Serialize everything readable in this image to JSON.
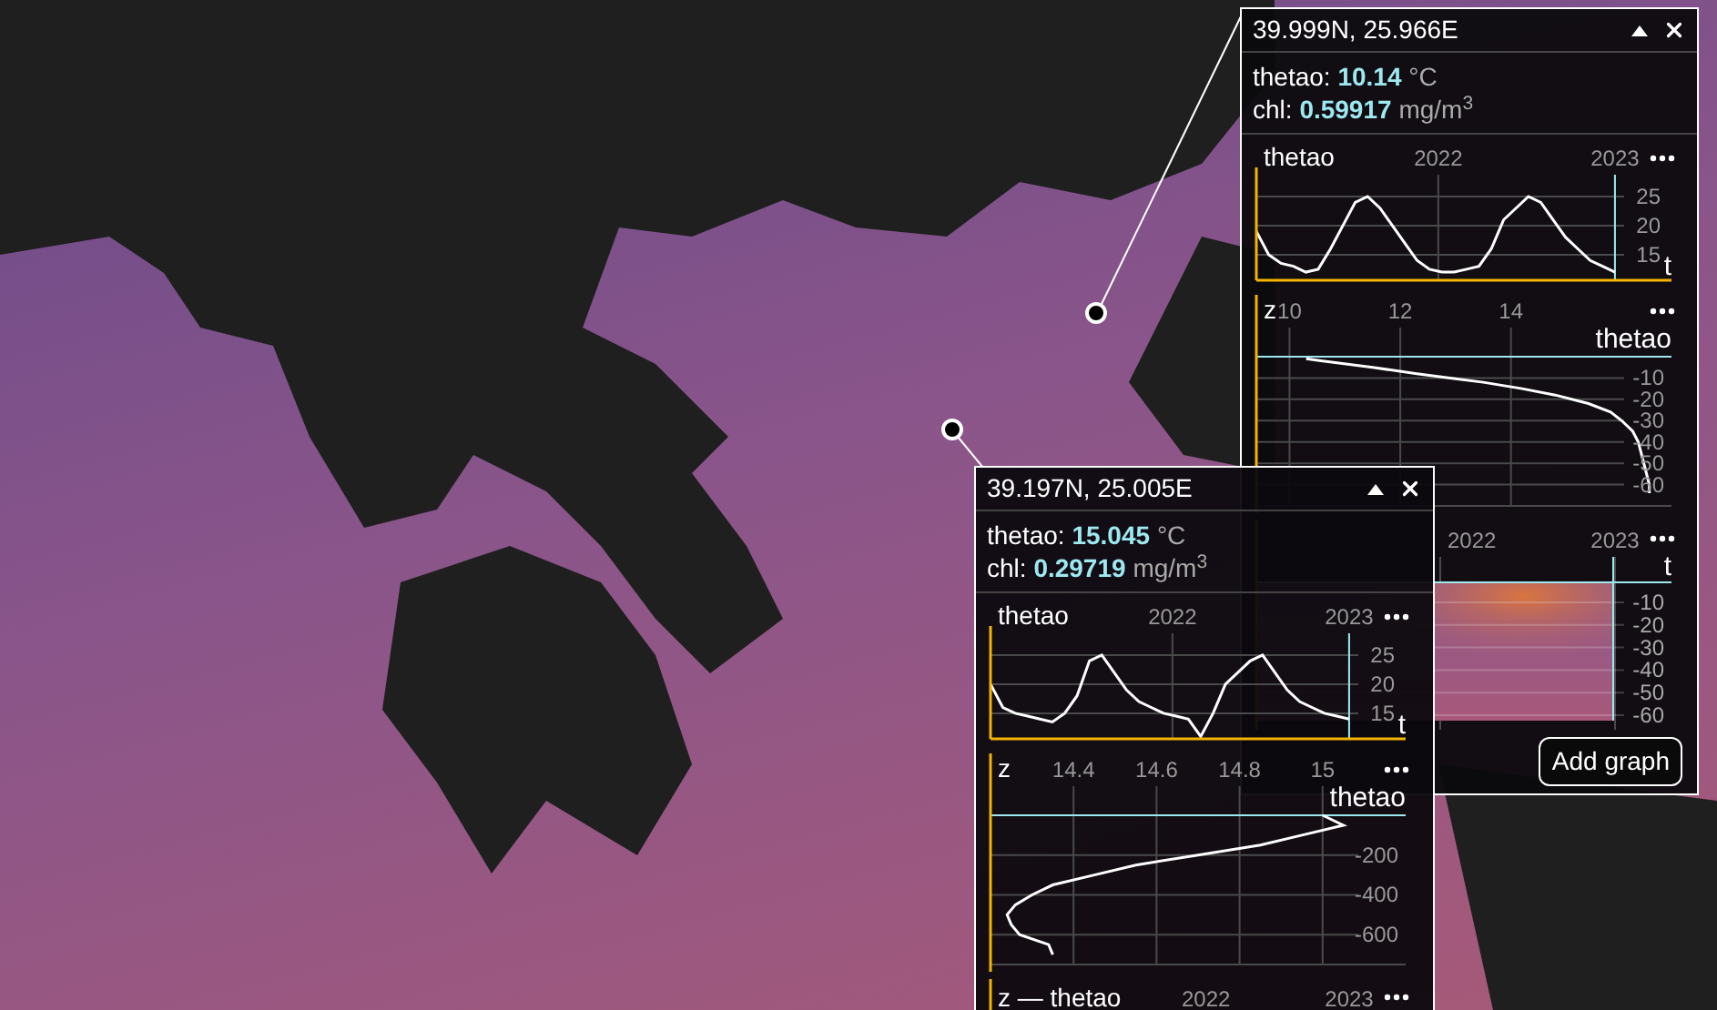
{
  "popups": [
    {
      "coordinates": "39.999N, 25.966E",
      "readings": [
        {
          "label": "thetao:",
          "value": "10.14",
          "unit": "°C"
        },
        {
          "label": "chl:",
          "value": "0.59917",
          "unit": "mg/m$^{3}$"
        }
      ],
      "graphs": [
        {
          "kind": "timeseries",
          "chart_data": {
            "type": "line",
            "title": "thetao",
            "xlabel": "t",
            "grid": true,
            "xlim": [
              2020.97,
              2023.32
            ],
            "ylim": [
              10.6,
              30
            ],
            "xticks": [
              2022,
              2023
            ],
            "yticks": [
              15,
              20,
              25
            ],
            "x": [
              2020.97,
              2021.04,
              2021.11,
              2021.18,
              2021.25,
              2021.32,
              2021.39,
              2021.46,
              2021.53,
              2021.6,
              2021.67,
              2021.74,
              2021.81,
              2021.88,
              2021.95,
              2022.02,
              2022.09,
              2022.16,
              2022.23,
              2022.3,
              2022.37,
              2022.44,
              2022.51,
              2022.58,
              2022.65,
              2022.72,
              2022.79,
              2022.86,
              2022.93,
              2023.0
            ],
            "series": [
              {
                "color": "#ffffff",
                "values": [
                  19,
                  15,
                  13.5,
                  13,
                  12,
                  12.5,
                  16,
                  20,
                  24,
                  25,
                  23,
                  20,
                  17,
                  14,
                  12.5,
                  12,
                  12,
                  12.5,
                  13,
                  16,
                  21,
                  23,
                  25,
                  24,
                  21,
                  18,
                  16,
                  14,
                  13,
                  12
                ]
              }
            ]
          }
        },
        {
          "kind": "profile",
          "chart_data": {
            "type": "line",
            "xlabel": "thetao",
            "ylabel": "z",
            "grid": true,
            "xlim": [
              9.4,
              16.9
            ],
            "ylim": [
              -70,
              0
            ],
            "xticks": [
              10,
              12,
              14
            ],
            "yticks": [
              -60,
              -50,
              -40,
              -30,
              -20,
              -10
            ],
            "x": [
              10.3,
              10.6,
              11.5,
              12.3,
              12.9,
              13.5,
              14.2,
              14.8,
              15.4,
              15.8,
              16.0,
              16.2,
              16.3,
              16.35,
              16.4,
              16.45,
              16.5,
              16.5
            ],
            "series": [
              {
                "color": "#ffffff",
                "values": [
                  -1,
                  -2,
                  -5,
                  -8,
                  -10,
                  -12,
                  -15,
                  -18,
                  -22,
                  -26,
                  -30,
                  -35,
                  -40,
                  -45,
                  -50,
                  -55,
                  -60,
                  -64
                ]
              }
            ]
          }
        },
        {
          "kind": "heatmap",
          "xticks": [
            "2022",
            "2023"
          ],
          "axis_label": "t",
          "yticks": [
            "-10",
            "-20",
            "-30",
            "-40",
            "-50",
            "-60"
          ]
        }
      ],
      "add_graph_button": "Add graph"
    },
    {
      "coordinates": "39.197N, 25.005E",
      "readings": [
        {
          "label": "thetao:",
          "value": "15.045",
          "unit": "°C"
        },
        {
          "label": "chl:",
          "value": "0.29719",
          "unit": "mg/m$^{3}$"
        }
      ],
      "graphs": [
        {
          "kind": "timeseries",
          "chart_data": {
            "type": "line",
            "title": "thetao",
            "xlabel": "t",
            "grid": true,
            "xlim": [
              2020.97,
              2023.32
            ],
            "ylim": [
              10.6,
              30
            ],
            "xticks": [
              2022,
              2023
            ],
            "yticks": [
              15,
              20,
              25
            ],
            "x": [
              2020.97,
              2021.04,
              2021.11,
              2021.18,
              2021.25,
              2021.32,
              2021.39,
              2021.46,
              2021.53,
              2021.6,
              2021.67,
              2021.74,
              2021.81,
              2021.88,
              2021.95,
              2022.02,
              2022.09,
              2022.16,
              2022.23,
              2022.3,
              2022.37,
              2022.44,
              2022.51,
              2022.58,
              2022.65,
              2022.72,
              2022.79,
              2022.86,
              2022.93,
              2023.0
            ],
            "series": [
              {
                "color": "#ffffff",
                "values": [
                  20,
                  16,
                  15,
                  14.5,
                  14,
                  13.5,
                  15,
                  18,
                  24,
                  25,
                  22,
                  19,
                  17,
                  16,
                  15,
                  14.5,
                  14,
                  11,
                  15,
                  20,
                  22,
                  24,
                  25,
                  22,
                  19,
                  17,
                  16,
                  15,
                  14.5,
                  14
                ]
              }
            ]
          }
        },
        {
          "kind": "profile",
          "chart_data": {
            "type": "line",
            "xlabel": "thetao",
            "ylabel": "z",
            "grid": true,
            "xlim": [
              14.2,
              15.2
            ],
            "ylim": [
              -750,
              0
            ],
            "xticks": [
              14.4,
              14.6,
              14.8,
              15
            ],
            "yticks": [
              -600,
              -400,
              -200
            ],
            "x": [
              15.0,
              15.05,
              14.95,
              14.85,
              14.7,
              14.55,
              14.45,
              14.35,
              14.3,
              14.26,
              14.24,
              14.25,
              14.27,
              14.34,
              14.35
            ],
            "series": [
              {
                "color": "#ffffff",
                "values": [
                  0,
                  -50,
                  -100,
                  -150,
                  -200,
                  -250,
                  -300,
                  -350,
                  -400,
                  -450,
                  -500,
                  -550,
                  -600,
                  -650,
                  -700
                ]
              }
            ]
          }
        },
        {
          "kind": "heatmap",
          "title": "z — thetao",
          "xticks": [
            "2022",
            "2023"
          ]
        }
      ]
    }
  ]
}
